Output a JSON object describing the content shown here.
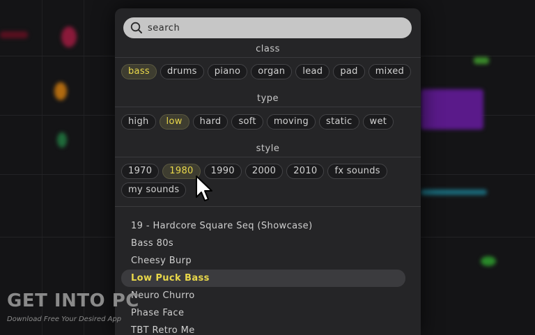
{
  "search": {
    "placeholder": "search"
  },
  "sections": {
    "class": {
      "title": "class",
      "chips": [
        "bass",
        "drums",
        "piano",
        "organ",
        "lead",
        "pad",
        "mixed"
      ],
      "selected": "bass"
    },
    "type": {
      "title": "type",
      "chips": [
        "high",
        "low",
        "hard",
        "soft",
        "moving",
        "static",
        "wet"
      ],
      "selected": "low"
    },
    "style": {
      "title": "style",
      "chips": [
        "1970",
        "1980",
        "1990",
        "2000",
        "2010",
        "fx sounds",
        "my sounds"
      ],
      "selected": "1980"
    }
  },
  "presets": {
    "items": [
      "19 - Hardcore Square Seq (Showcase)",
      "Bass 80s",
      "Cheesy Burp",
      "Low Puck Bass",
      "Neuro Churro",
      "Phase Face",
      "TBT Retro Me"
    ],
    "selected": "Low Puck Bass"
  },
  "watermark": {
    "title": "GET INTO PC",
    "subtitle": "Download Free Your Desired App"
  },
  "colors": {
    "accent": "#e9d84a",
    "panel": "#252527",
    "search_bg": "#c6c6c6"
  },
  "icons": {
    "search": "search-icon",
    "cursor": "mouse-pointer-icon"
  }
}
